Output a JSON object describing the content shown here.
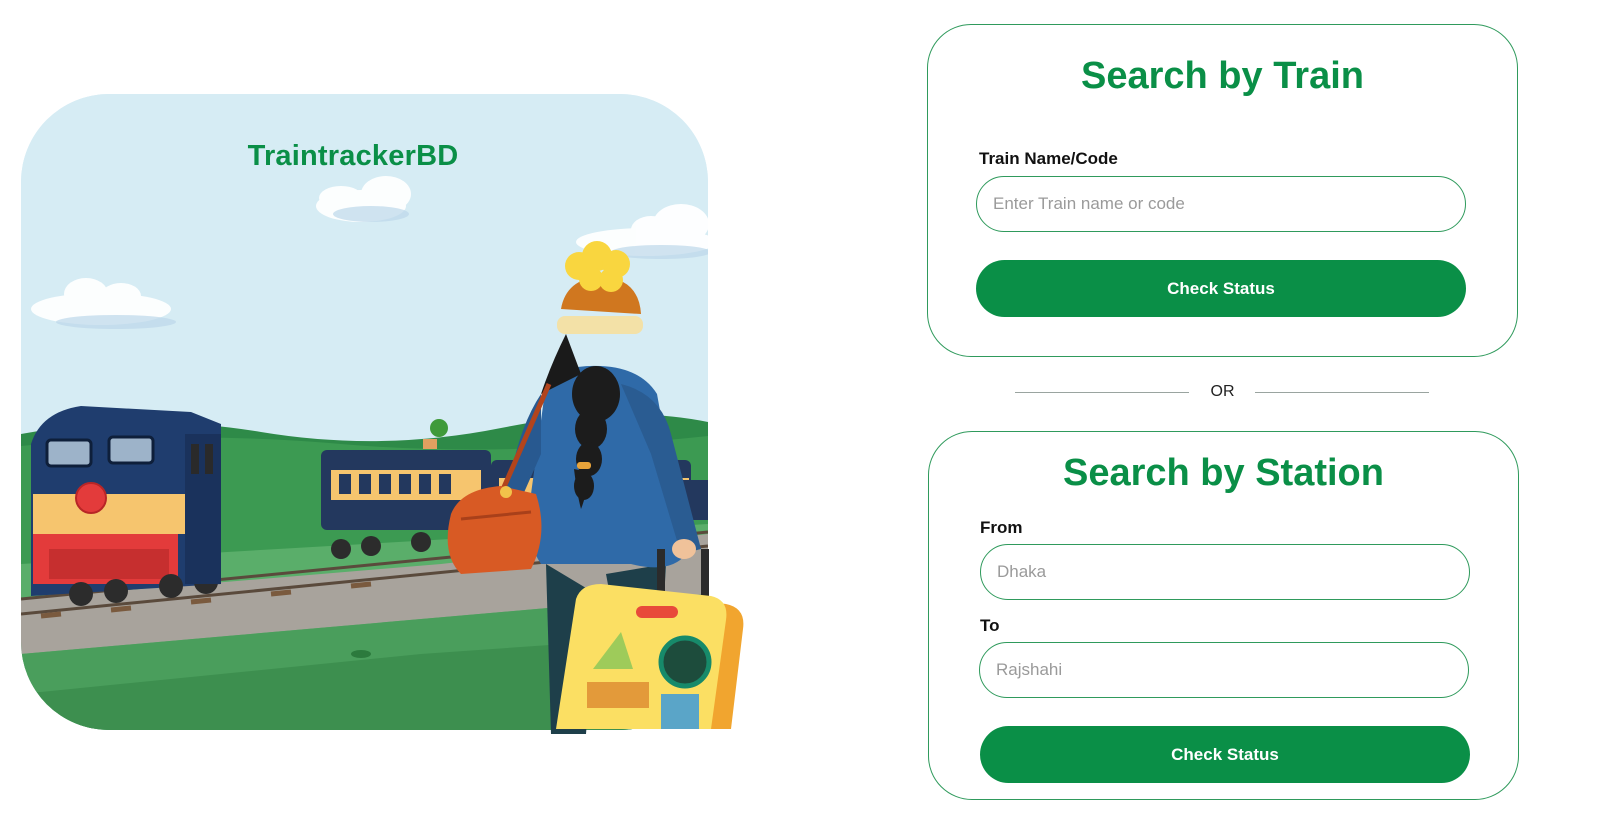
{
  "brand": {
    "name": "TraintrackerBD",
    "color": "#0a8f47"
  },
  "search_by_train": {
    "title": "Search by Train",
    "train_label": "Train Name/Code",
    "train_placeholder": "Enter Train name or code",
    "train_value": "",
    "button_label": "Check Status"
  },
  "divider": {
    "label": "OR"
  },
  "search_by_station": {
    "title": "Search by Station",
    "from_label": "From",
    "from_placeholder": "Dhaka",
    "from_value": "",
    "to_label": "To",
    "to_placeholder": "Rajshahi",
    "to_value": "",
    "button_label": "Check Status"
  },
  "colors": {
    "accent": "#0a8f47",
    "border": "#2f9a5c",
    "sky": "#d6ecf4"
  }
}
